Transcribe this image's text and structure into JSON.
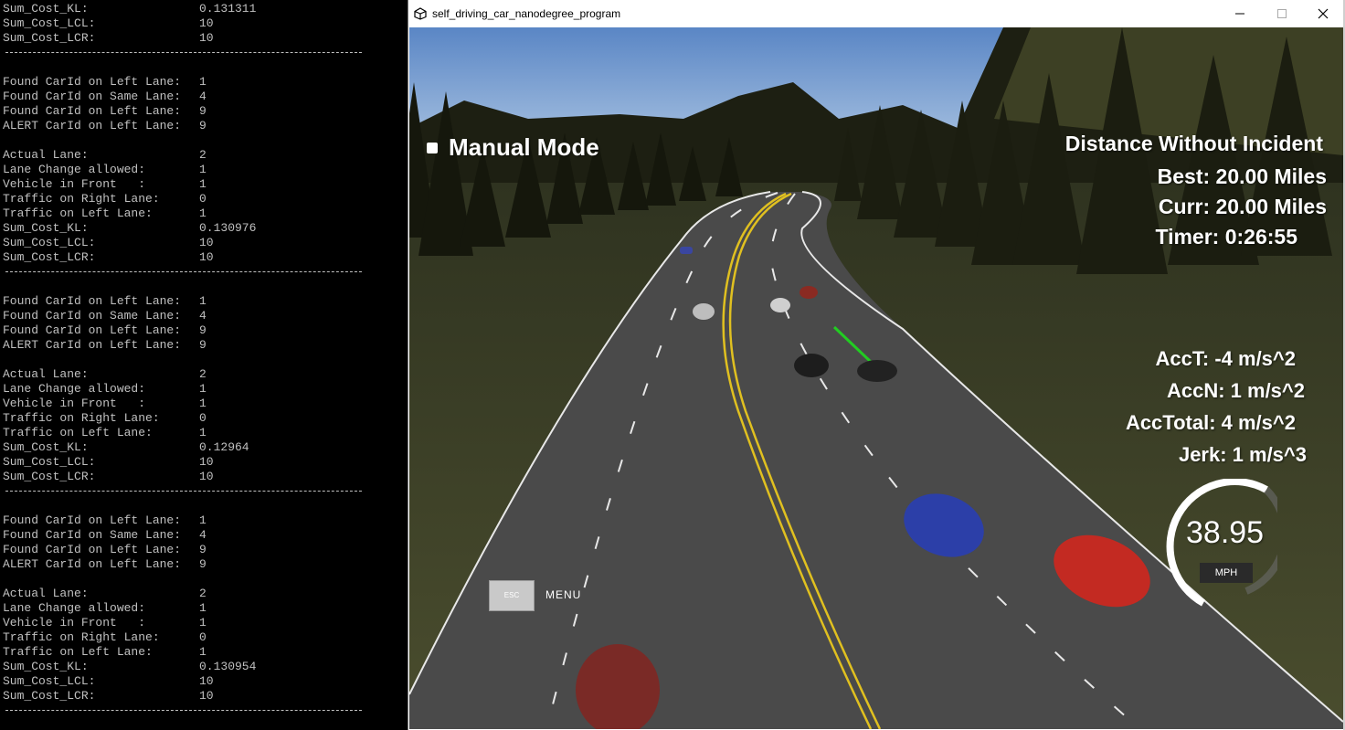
{
  "console": {
    "blocks": [
      {
        "type": "kv",
        "label": "Sum_Cost_KL:",
        "value": "0.131311"
      },
      {
        "type": "kv",
        "label": "Sum_Cost_LCL:",
        "value": "10"
      },
      {
        "type": "kv",
        "label": "Sum_Cost_LCR:",
        "value": "10"
      },
      {
        "type": "sep"
      },
      {
        "type": "blank"
      },
      {
        "type": "kv",
        "label": "Found CarId on Left Lane:",
        "value": "1"
      },
      {
        "type": "kv",
        "label": "Found CarId on Same Lane:",
        "value": "4"
      },
      {
        "type": "kv",
        "label": "Found CarId on Left Lane:",
        "value": "9"
      },
      {
        "type": "kv",
        "label": "ALERT CarId on Left Lane:",
        "value": "9"
      },
      {
        "type": "blank"
      },
      {
        "type": "kv",
        "label": "Actual Lane:",
        "value": "2"
      },
      {
        "type": "kv",
        "label": "Lane Change allowed:",
        "value": "1"
      },
      {
        "type": "kv",
        "label": "Vehicle in Front   :",
        "value": "1"
      },
      {
        "type": "kv",
        "label": "Traffic on Right Lane:",
        "value": "0"
      },
      {
        "type": "kv",
        "label": "Traffic on Left Lane:",
        "value": "1"
      },
      {
        "type": "kv",
        "label": "Sum_Cost_KL:",
        "value": "0.130976"
      },
      {
        "type": "kv",
        "label": "Sum_Cost_LCL:",
        "value": "10"
      },
      {
        "type": "kv",
        "label": "Sum_Cost_LCR:",
        "value": "10"
      },
      {
        "type": "sep"
      },
      {
        "type": "blank"
      },
      {
        "type": "kv",
        "label": "Found CarId on Left Lane:",
        "value": "1"
      },
      {
        "type": "kv",
        "label": "Found CarId on Same Lane:",
        "value": "4"
      },
      {
        "type": "kv",
        "label": "Found CarId on Left Lane:",
        "value": "9"
      },
      {
        "type": "kv",
        "label": "ALERT CarId on Left Lane:",
        "value": "9"
      },
      {
        "type": "blank"
      },
      {
        "type": "kv",
        "label": "Actual Lane:",
        "value": "2"
      },
      {
        "type": "kv",
        "label": "Lane Change allowed:",
        "value": "1"
      },
      {
        "type": "kv",
        "label": "Vehicle in Front   :",
        "value": "1"
      },
      {
        "type": "kv",
        "label": "Traffic on Right Lane:",
        "value": "0"
      },
      {
        "type": "kv",
        "label": "Traffic on Left Lane:",
        "value": "1"
      },
      {
        "type": "kv",
        "label": "Sum_Cost_KL:",
        "value": "0.12964"
      },
      {
        "type": "kv",
        "label": "Sum_Cost_LCL:",
        "value": "10"
      },
      {
        "type": "kv",
        "label": "Sum_Cost_LCR:",
        "value": "10"
      },
      {
        "type": "sep"
      },
      {
        "type": "blank"
      },
      {
        "type": "kv",
        "label": "Found CarId on Left Lane:",
        "value": "1"
      },
      {
        "type": "kv",
        "label": "Found CarId on Same Lane:",
        "value": "4"
      },
      {
        "type": "kv",
        "label": "Found CarId on Left Lane:",
        "value": "9"
      },
      {
        "type": "kv",
        "label": "ALERT CarId on Left Lane:",
        "value": "9"
      },
      {
        "type": "blank"
      },
      {
        "type": "kv",
        "label": "Actual Lane:",
        "value": "2"
      },
      {
        "type": "kv",
        "label": "Lane Change allowed:",
        "value": "1"
      },
      {
        "type": "kv",
        "label": "Vehicle in Front   :",
        "value": "1"
      },
      {
        "type": "kv",
        "label": "Traffic on Right Lane:",
        "value": "0"
      },
      {
        "type": "kv",
        "label": "Traffic on Left Lane:",
        "value": "1"
      },
      {
        "type": "kv",
        "label": "Sum_Cost_KL:",
        "value": "0.130954"
      },
      {
        "type": "kv",
        "label": "Sum_Cost_LCL:",
        "value": "10"
      },
      {
        "type": "kv",
        "label": "Sum_Cost_LCR:",
        "value": "10"
      },
      {
        "type": "sep"
      }
    ]
  },
  "window": {
    "title": "self_driving_car_nanodegree_program",
    "icon": "unity-icon",
    "controls": [
      "minimize-icon",
      "maximize-icon",
      "close-icon"
    ]
  },
  "hud": {
    "manual_mode": "Manual Mode",
    "distance_title": "Distance Without Incident",
    "best": "Best: 20.00 Miles",
    "curr": "Curr: 20.00 Miles",
    "timer": "Timer: 0:26:55",
    "acc_t": "AccT: -4 m/s^2",
    "acc_n": "AccN: 1 m/s^2",
    "acc_total": "AccTotal: 4 m/s^2",
    "jerk": "Jerk: 1 m/s^3",
    "speed": "38.95",
    "speed_unit": "MPH",
    "esc_label": "ESC",
    "menu_label": "MENU"
  },
  "colors": {
    "console_text": "#c0c0c0",
    "console_bg": "#000000",
    "sky_top": "#5a86c5",
    "sky_bottom": "#cfe0ef",
    "grass": "#3b3f26",
    "road": "#4a4a4a",
    "center_line": "#e0c020"
  }
}
